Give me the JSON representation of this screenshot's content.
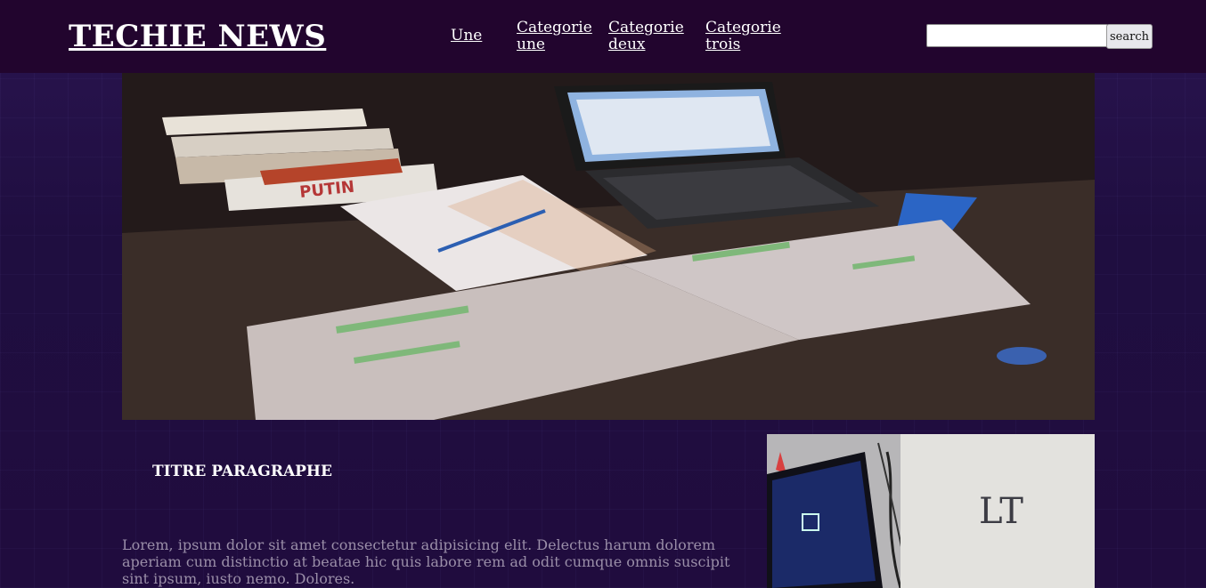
{
  "header": {
    "logo": "TECHIE NEWS",
    "nav": [
      "Une",
      "Categorie une",
      "Categorie deux",
      "Categorie trois"
    ],
    "search": {
      "placeholder": "",
      "value": "",
      "button": "search"
    }
  },
  "hero": {
    "cover_text": "PUTIN"
  },
  "article": {
    "title": "TITRE PARAGRAPHE",
    "body": "Lorem, ipsum dolor sit amet consectetur adipisicing elit. Delectus harum dolorem aperiam cum distinctio at beatae hic quis labore rem ad odit cumque omnis suscipit sint ipsum, iusto nemo. Dolores."
  },
  "side_image": {
    "logo_text": "LT"
  }
}
